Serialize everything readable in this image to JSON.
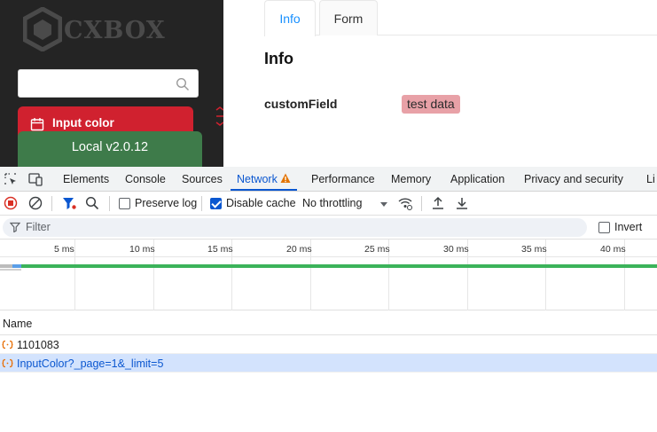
{
  "app": {
    "logo_text": "CXBOX",
    "search": {
      "value": "",
      "placeholder": ""
    },
    "sidebar": {
      "active_item": {
        "label": "Input color",
        "icon": "calendar-icon"
      },
      "version": "Local  v2.0.12"
    },
    "tabs": [
      {
        "label": "Info",
        "active": true
      },
      {
        "label": "Form",
        "active": false
      }
    ],
    "page_title": "Info",
    "field": {
      "label": "customField",
      "value": "test data"
    }
  },
  "devtools": {
    "tabs": [
      {
        "label": "Elements",
        "active": false
      },
      {
        "label": "Console",
        "active": false
      },
      {
        "label": "Sources",
        "active": false
      },
      {
        "label": "Network",
        "active": true,
        "warning": true
      },
      {
        "label": "Performance",
        "active": false
      },
      {
        "label": "Memory",
        "active": false
      },
      {
        "label": "Application",
        "active": false
      },
      {
        "label": "Privacy and security",
        "active": false
      },
      {
        "label": "Li",
        "active": false
      }
    ],
    "toolbar": {
      "preserve_log": {
        "label": "Preserve log",
        "checked": false
      },
      "disable_cache": {
        "label": "Disable cache",
        "checked": true
      },
      "throttling": "No throttling"
    },
    "filter": {
      "placeholder": "Filter",
      "invert_label": "Invert",
      "invert_checked": false
    },
    "timeline_ticks": [
      "5 ms",
      "10 ms",
      "15 ms",
      "20 ms",
      "25 ms",
      "30 ms",
      "35 ms",
      "40 ms"
    ],
    "table": {
      "columns": [
        "Name"
      ],
      "rows": [
        {
          "name": "1101083",
          "selected": false
        },
        {
          "name": "InputColor?_page=1&_limit=5",
          "selected": true
        }
      ]
    }
  },
  "colors": {
    "sidebar_bg": "#242424",
    "active_menu": "#d0212f",
    "version_badge": "#3e7b4a",
    "tab_active": "#1890ff",
    "tag_bg": "#e8a1a7",
    "devtools_accent": "#0b57d0",
    "waterfall_green": "#3bb35a"
  }
}
